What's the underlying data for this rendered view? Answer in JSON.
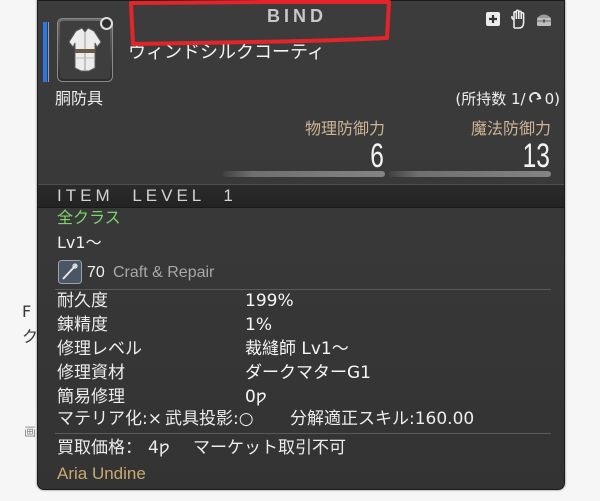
{
  "background_fragments": {
    "f": "F",
    "ku": "ク",
    "ga": "画"
  },
  "tooltip": {
    "bind_label": "BIND",
    "top_icons": [
      "plus-box-icon",
      "hand-icon",
      "chest-icon"
    ],
    "item": {
      "icon": "body-armor-icon",
      "name": "ウィンドシルクコーティ",
      "category": "胴防具",
      "holdings_prefix": "(所持数 1/",
      "holdings_icon": "hq-icon",
      "holdings_suffix": "0)"
    },
    "stats": [
      {
        "label": "物理防御力",
        "value": "6"
      },
      {
        "label": "魔法防御力",
        "value": "13"
      }
    ],
    "item_level": "ITEM LEVEL 1",
    "classes": "全クラス",
    "level_requirement": "Lv1～",
    "repair": {
      "icon": "needle-icon",
      "level": "70",
      "label": "Craft & Repair"
    },
    "details": [
      {
        "label": "耐久度",
        "value": "199%"
      },
      {
        "label": "錬精度",
        "value": "1%"
      },
      {
        "label": "修理レベル",
        "value": "裁縫師 Lv1～"
      },
      {
        "label": "修理資材",
        "value": "ダークマターG1"
      },
      {
        "label": "簡易修理",
        "value": "0ƿ"
      }
    ],
    "flags": {
      "materia": "マテリア化:×",
      "glamour": "武具投影:○",
      "desynth": "分解適正スキル:160.00"
    },
    "sell": {
      "label": "買取価格：",
      "price": "4ƿ",
      "market": "マーケット取引不可"
    },
    "crafter": "Aria Undine"
  },
  "colors": {
    "annotation_red": "#e3242b",
    "class_green": "#7fd36f",
    "stat_label_tan": "#cdb596",
    "crafter_gold": "#c9a96e",
    "job_blue": "#2b78e4",
    "muted_gray": "#a8a8a8",
    "panel_bg": "#363636"
  }
}
